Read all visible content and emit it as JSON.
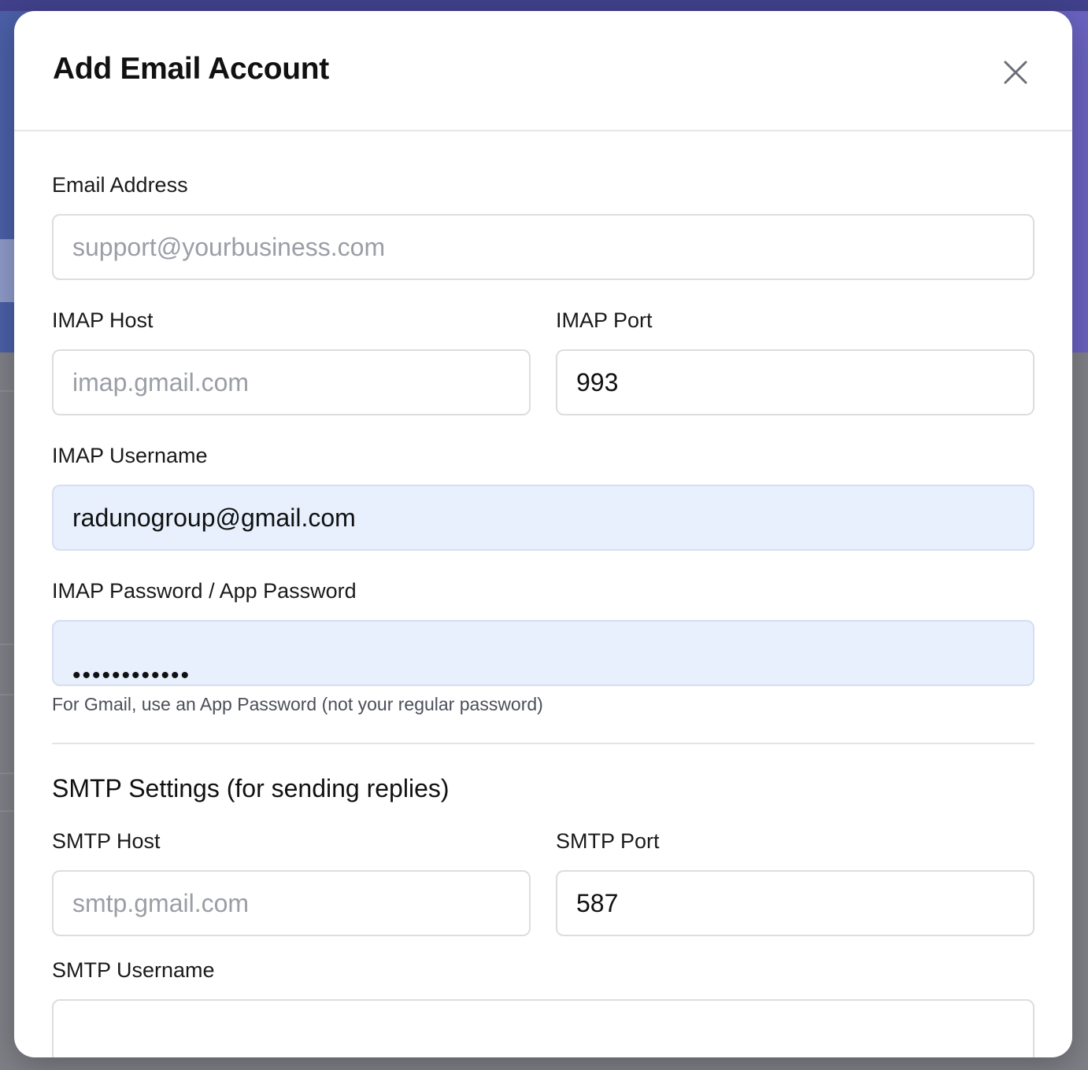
{
  "modal": {
    "title": "Add Email Account",
    "close_icon": "close-icon"
  },
  "form": {
    "email_address": {
      "label": "Email Address",
      "placeholder": "support@yourbusiness.com",
      "value": ""
    },
    "imap_host": {
      "label": "IMAP Host",
      "placeholder": "imap.gmail.com",
      "value": ""
    },
    "imap_port": {
      "label": "IMAP Port",
      "value": "993"
    },
    "imap_username": {
      "label": "IMAP Username",
      "value": "radunogroup@gmail.com"
    },
    "imap_password": {
      "label": "IMAP Password / App Password",
      "masked": "••••••••••••"
    },
    "help_text": "For Gmail, use an App Password (not your regular password)",
    "smtp_section_title": "SMTP Settings (for sending replies)",
    "smtp_host": {
      "label": "SMTP Host",
      "placeholder": "smtp.gmail.com",
      "value": ""
    },
    "smtp_port": {
      "label": "SMTP Port",
      "value": "587"
    },
    "smtp_username": {
      "label": "SMTP Username",
      "value": ""
    }
  },
  "colors": {
    "autofill_bg": "#e8f0fe",
    "backdrop": "#7f8087",
    "hero": "#5a5fb2"
  }
}
